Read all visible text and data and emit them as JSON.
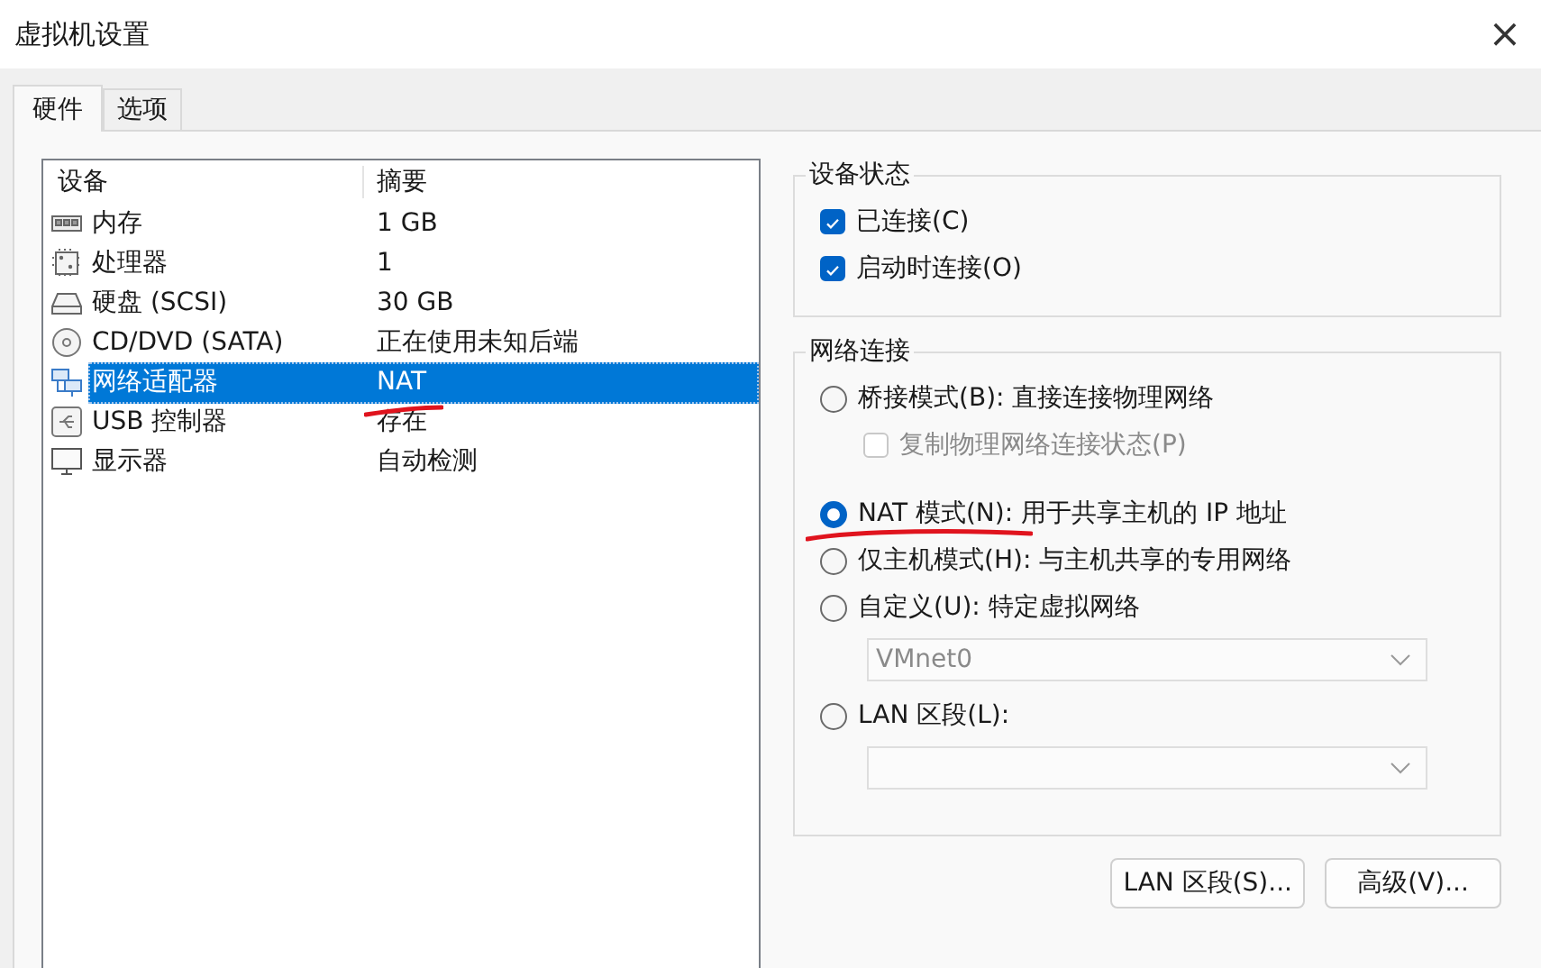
{
  "window": {
    "title": "虚拟机设置",
    "close": "×"
  },
  "tabs": [
    {
      "label": "硬件",
      "selected": true
    },
    {
      "label": "选项",
      "selected": false
    }
  ],
  "device_list": {
    "columns": [
      "设备",
      "摘要"
    ],
    "rows": [
      {
        "kind": "memory",
        "device": "内存",
        "summary": "1 GB",
        "selected": false
      },
      {
        "kind": "cpu",
        "device": "处理器",
        "summary": "1",
        "selected": false
      },
      {
        "kind": "disk",
        "device": "硬盘 (SCSI)",
        "summary": "30 GB",
        "selected": false
      },
      {
        "kind": "cd",
        "device": "CD/DVD (SATA)",
        "summary": "正在使用未知后端",
        "selected": false
      },
      {
        "kind": "network",
        "device": "网络适配器",
        "summary": "NAT",
        "selected": true
      },
      {
        "kind": "usb",
        "device": "USB 控制器",
        "summary": "存在",
        "selected": false
      },
      {
        "kind": "display",
        "device": "显示器",
        "summary": "自动检测",
        "selected": false
      }
    ]
  },
  "device_status": {
    "title": "设备状态",
    "options": [
      {
        "label": "已连接(C)",
        "checked": true
      },
      {
        "label": "启动时连接(O)",
        "checked": true
      }
    ]
  },
  "network_connection": {
    "title": "网络连接",
    "items": [
      {
        "kind": "radio",
        "label": "桥接模式(B): 直接连接物理网络",
        "selected": false
      },
      {
        "kind": "checkbox",
        "label": "复制物理网络连接状态(P)",
        "checked": false,
        "disabled": true
      },
      {
        "kind": "radio",
        "label": "NAT 模式(N): 用于共享主机的 IP 地址",
        "selected": true
      },
      {
        "kind": "radio",
        "label": "仅主机模式(H): 与主机共享的专用网络",
        "selected": false
      },
      {
        "kind": "radio",
        "label": "自定义(U): 特定虚拟网络",
        "selected": false
      },
      {
        "kind": "select",
        "value": "VMnet0",
        "disabled": true
      },
      {
        "kind": "radio",
        "label": "LAN 区段(L):",
        "selected": false
      },
      {
        "kind": "select",
        "disabled": true
      }
    ]
  },
  "buttons": [
    "LAN 区段(S)...",
    "高级(V)..."
  ]
}
